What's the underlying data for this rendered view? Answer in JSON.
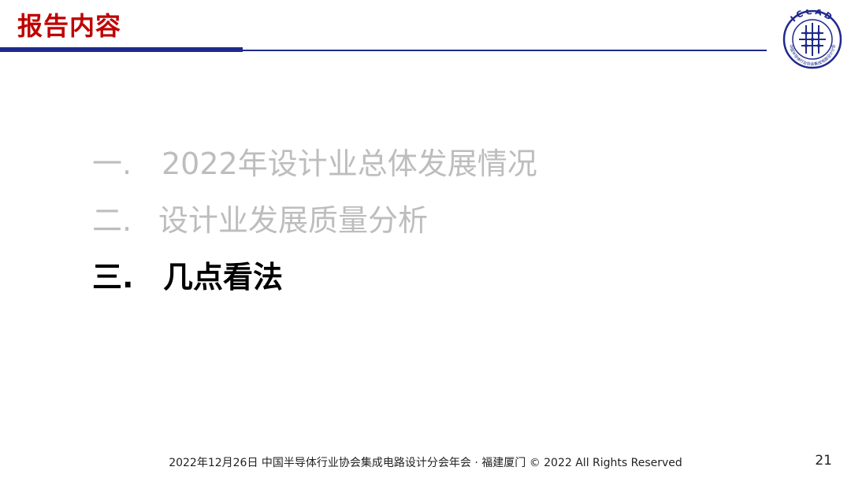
{
  "header": {
    "title": "报告内容",
    "logo_text": "ICCAD",
    "logo_caption": "中国半导体行业协会集成电路设计分会",
    "brand_color": "#1f2a8c",
    "title_color": "#c00000"
  },
  "agenda": {
    "items": [
      {
        "number": "一.",
        "label": "2022年设计业总体发展情况",
        "state": "dim"
      },
      {
        "number": "二.",
        "label": "设计业发展质量分析",
        "state": "dim"
      },
      {
        "number": "三.",
        "label": "几点看法",
        "state": "active"
      }
    ]
  },
  "footer": {
    "text": "2022年12月26日 中国半导体行业协会集成电路设计分会年会 · 福建厦门 © 2022 All Rights Reserved",
    "page_number": "21"
  }
}
